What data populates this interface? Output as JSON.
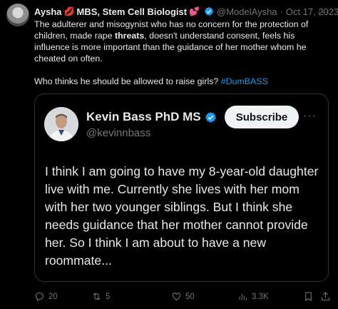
{
  "tweet": {
    "author_name": "Aysha",
    "author_name_tail": "MBS, Stem Cell Biologist",
    "emoji_lips": "💋",
    "emoji_heart": "💕",
    "handle": "@ModelAysha",
    "separator": "·",
    "date": "Oct 17, 2023",
    "more": "···",
    "text_1": "The adulterer and misogynist who has no concern for the protection of children, made rape ",
    "text_bold": "threats",
    "text_2": ", doesn't understand consent, feels his influence is more important than the guidance of her mother whom he cheated on often.",
    "text_3": "Who thinks he should be allowed to raise girls? ",
    "hashtag": "#DumBASS"
  },
  "quoted": {
    "name": "Kevin Bass PhD MS",
    "handle": "@kevinnbass",
    "subscribe_label": "Subscribe",
    "more": "···",
    "text": "I think I am going to have my 8-year-old daughter live with me. Currently she lives with her mom with her two younger siblings. But I think she needs guidance that her mother cannot provide her. So I think I am about to have a new roommate..."
  },
  "actions": {
    "replies": "20",
    "retweets": "5",
    "likes": "50",
    "views": "3.3K"
  },
  "colors": {
    "background": "#000000",
    "text": "#e7e9ea",
    "muted": "#71767b",
    "link": "#1d9bf0",
    "verified": "#1d9bf0"
  }
}
